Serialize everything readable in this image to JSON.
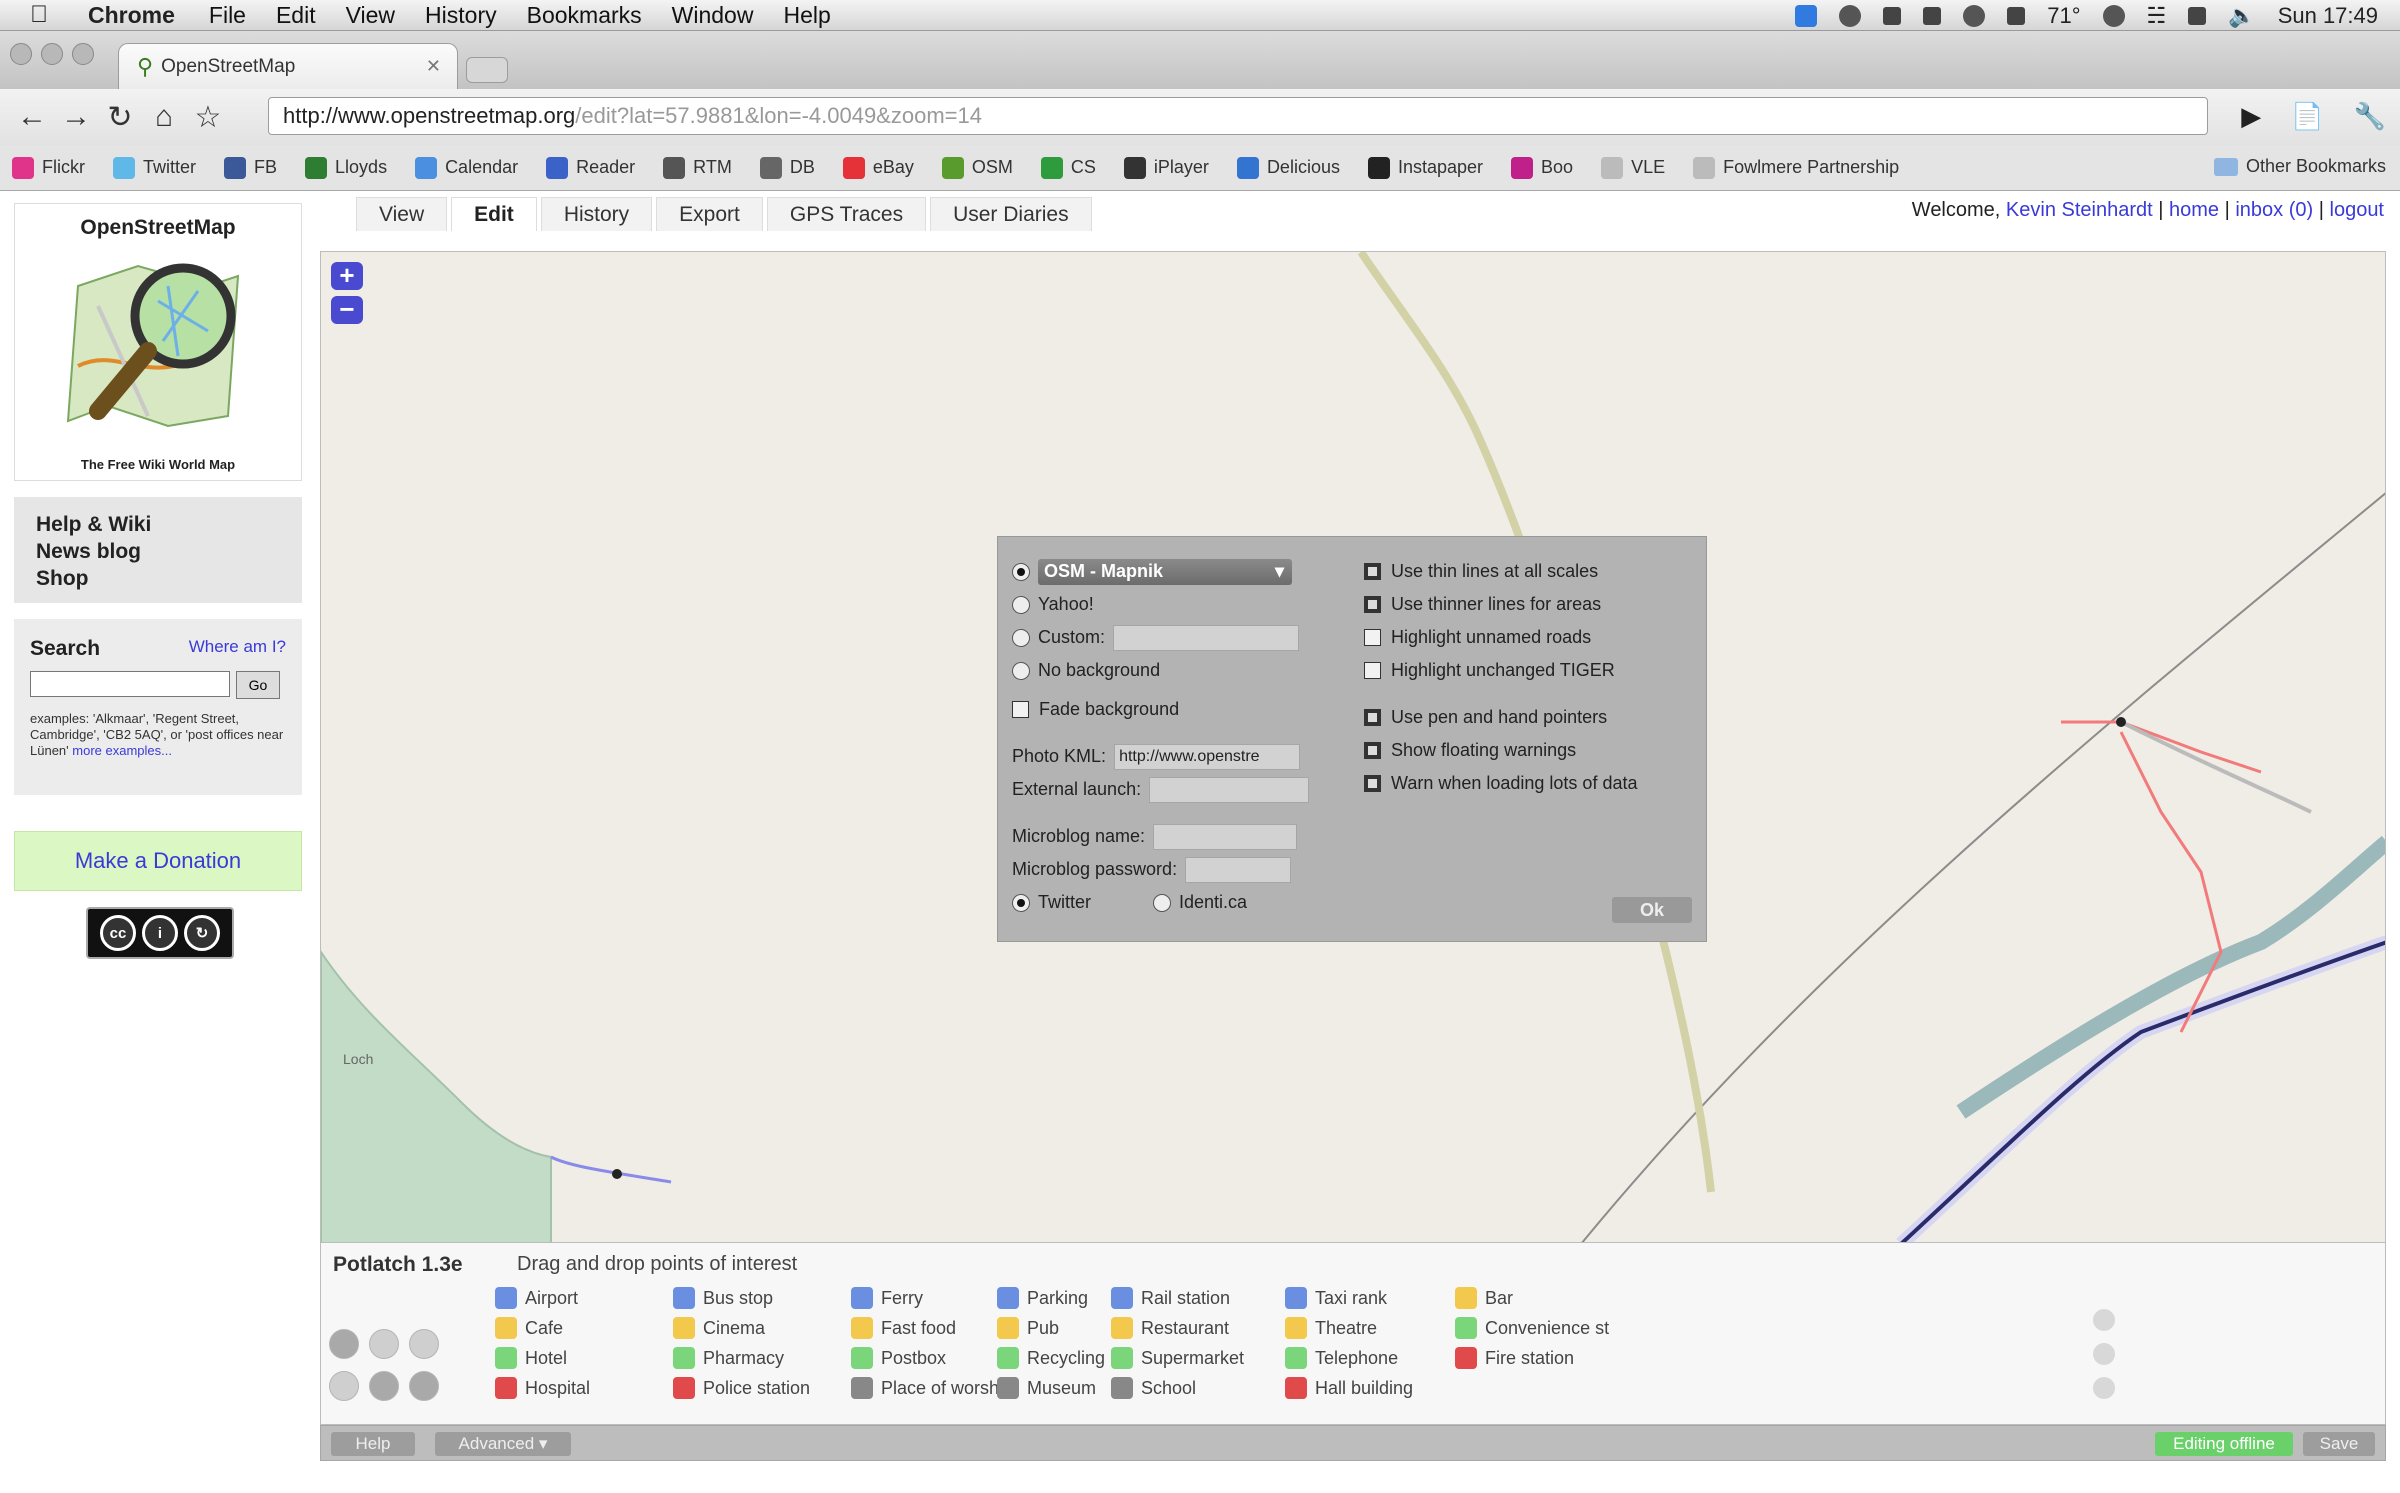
{
  "menubar": {
    "app": "Chrome",
    "items": [
      "File",
      "Edit",
      "View",
      "History",
      "Bookmarks",
      "Window",
      "Help"
    ],
    "temperature": "71°",
    "clock": "Sun 17:49"
  },
  "browser": {
    "tab_title": "OpenStreetMap",
    "url_host": "http://www.openstreetmap.org",
    "url_path": "/edit?lat=57.9881&lon=-4.0049&zoom=14",
    "bookmarks": [
      {
        "label": "Flickr",
        "color": "#e0338a"
      },
      {
        "label": "Twitter",
        "color": "#5fb8e8"
      },
      {
        "label": "FB",
        "color": "#3b5998"
      },
      {
        "label": "Lloyds",
        "color": "#2e7d32"
      },
      {
        "label": "Calendar",
        "color": "#4a8fe0"
      },
      {
        "label": "Reader",
        "color": "#3a62c8"
      },
      {
        "label": "RTM",
        "color": "#555555"
      },
      {
        "label": "DB",
        "color": "#666666"
      },
      {
        "label": "eBay",
        "color": "#e53238"
      },
      {
        "label": "OSM",
        "color": "#5a9b2e"
      },
      {
        "label": "CS",
        "color": "#2e9b3c"
      },
      {
        "label": "iPlayer",
        "color": "#333333"
      },
      {
        "label": "Delicious",
        "color": "#3274d0"
      },
      {
        "label": "Instapaper",
        "color": "#222222"
      },
      {
        "label": "Boo",
        "color": "#c0208a"
      },
      {
        "label": "VLE",
        "color": "#bbbbbb"
      },
      {
        "label": "Fowlmere Partnership",
        "color": "#bbbbbb"
      }
    ],
    "other_bookmarks": "Other Bookmarks"
  },
  "sidebar": {
    "logo_title": "OpenStreetMap",
    "logo_subtitle": "The Free Wiki World Map",
    "nav": [
      "Help & Wiki",
      "News blog",
      "Shop"
    ],
    "search_label": "Search",
    "where_am_i": "Where am I?",
    "go_label": "Go",
    "examples": "examples: 'Alkmaar', 'Regent Street, Cambridge', 'CB2 5AQ', or 'post offices near Lünen'",
    "more_examples": "more examples...",
    "donate": "Make a Donation",
    "license": "CC BY SA"
  },
  "header": {
    "tabs": [
      "View",
      "Edit",
      "History",
      "Export",
      "GPS Traces",
      "User Diaries"
    ],
    "active_tab": "Edit",
    "welcome": "Welcome,",
    "user": "Kevin Steinhardt",
    "home": "home",
    "inbox": "inbox (0)",
    "logout": "logout",
    "sep": "|"
  },
  "map": {
    "zoom_in": "+",
    "zoom_out": "−",
    "place_label": "Loch"
  },
  "dialog": {
    "bg_selected": "OSM - Mapnik",
    "bg_options": [
      "Yahoo!",
      "Custom:",
      "No background"
    ],
    "fade_background": "Fade background",
    "photo_kml_label": "Photo KML:",
    "photo_kml_value": "http://www.openstre",
    "external_launch_label": "External launch:",
    "microblog_name_label": "Microblog name:",
    "microblog_password_label": "Microblog password:",
    "services": [
      "Twitter",
      "Identi.ca"
    ],
    "options": [
      {
        "label": "Use thin lines at all scales",
        "checked": true
      },
      {
        "label": "Use thinner lines for areas",
        "checked": true
      },
      {
        "label": "Highlight unnamed roads",
        "checked": false
      },
      {
        "label": "Highlight unchanged TIGER",
        "checked": false
      },
      {
        "label": "Use pen and hand pointers",
        "checked": true
      },
      {
        "label": "Show floating warnings",
        "checked": true
      },
      {
        "label": "Warn when loading lots of data",
        "checked": true
      }
    ],
    "ok": "Ok"
  },
  "potlatch": {
    "title": "Potlatch 1.3e",
    "hint": "Drag and drop points of interest",
    "poi_columns": [
      [
        {
          "label": "Airport",
          "color": "#6b8fe0"
        },
        {
          "label": "Cafe",
          "color": "#f2c94c"
        },
        {
          "label": "Hotel",
          "color": "#7bd67b"
        },
        {
          "label": "Hospital",
          "color": "#e04a4a"
        }
      ],
      [
        {
          "label": "Bus stop",
          "color": "#6b8fe0"
        },
        {
          "label": "Cinema",
          "color": "#f2c94c"
        },
        {
          "label": "Pharmacy",
          "color": "#7bd67b"
        },
        {
          "label": "Police station",
          "color": "#e04a4a"
        }
      ],
      [
        {
          "label": "Ferry",
          "color": "#6b8fe0"
        },
        {
          "label": "Fast food",
          "color": "#f2c94c"
        },
        {
          "label": "Postbox",
          "color": "#7bd67b"
        },
        {
          "label": "Place of worship",
          "color": "#888888"
        }
      ],
      [
        {
          "label": "Parking",
          "color": "#6b8fe0"
        },
        {
          "label": "Pub",
          "color": "#f2c94c"
        },
        {
          "label": "Recycling",
          "color": "#7bd67b"
        },
        {
          "label": "Museum",
          "color": "#888888"
        }
      ],
      [
        {
          "label": "Rail station",
          "color": "#6b8fe0"
        },
        {
          "label": "Restaurant",
          "color": "#f2c94c"
        },
        {
          "label": "Supermarket",
          "color": "#7bd67b"
        },
        {
          "label": "School",
          "color": "#888888"
        }
      ],
      [
        {
          "label": "Taxi rank",
          "color": "#6b8fe0"
        },
        {
          "label": "Theatre",
          "color": "#f2c94c"
        },
        {
          "label": "Telephone",
          "color": "#7bd67b"
        },
        {
          "label": "Hall building",
          "color": "#e04a4a"
        }
      ],
      [
        {
          "label": "Bar",
          "color": "#f2c94c"
        },
        {
          "label": "Convenience st",
          "color": "#7bd67b"
        },
        {
          "label": "Fire station",
          "color": "#e04a4a"
        }
      ]
    ],
    "help": "Help",
    "advanced": "Advanced",
    "editing_status": "Editing offline",
    "save": "Save"
  }
}
